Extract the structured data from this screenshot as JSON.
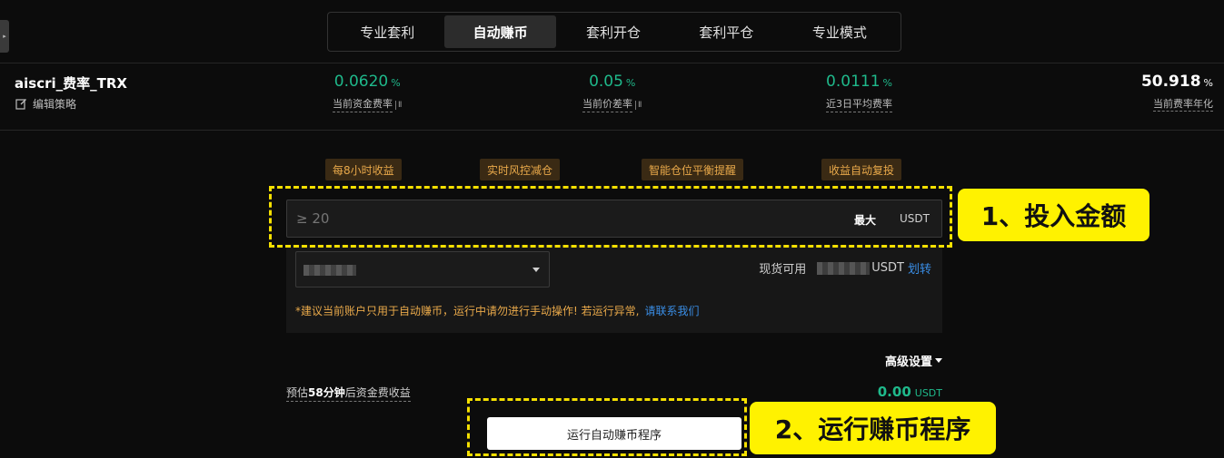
{
  "tabs": [
    {
      "label": "专业套利",
      "active": false
    },
    {
      "label": "自动赚币",
      "active": true
    },
    {
      "label": "套利开仓",
      "active": false
    },
    {
      "label": "套利平仓",
      "active": false
    },
    {
      "label": "专业模式",
      "active": false
    }
  ],
  "strategy": {
    "name": "aiscri_费率_TRX",
    "edit_label": "编辑策略"
  },
  "stats": {
    "current_funding": {
      "value": "0.0620",
      "unit": "%",
      "label": "当前资金费率"
    },
    "current_spread": {
      "value": "0.05",
      "unit": "%",
      "label": "当前价差率"
    },
    "avg_3day": {
      "value": "0.0111",
      "unit": "%",
      "label": "近3日平均费率"
    },
    "annualized": {
      "value": "50.918",
      "unit": "%",
      "label": "当前费率年化"
    }
  },
  "features": [
    "每8小时收益",
    "实时风控减仓",
    "智能仓位平衡提醒",
    "收益自动复投"
  ],
  "amount_input": {
    "placeholder": "≥ 20",
    "max_label": "最大",
    "currency": "USDT"
  },
  "account": {
    "available_label": "现货可用",
    "currency": "USDT",
    "transfer_label": "划转"
  },
  "notice": {
    "text": "*建议当前账户只用于自动赚币，运行中请勿进行手动操作! 若运行异常,",
    "link": "请联系我们"
  },
  "advanced_label": "高级设置",
  "estimate": {
    "prefix": "预估",
    "minutes": "58分钟",
    "suffix": "后资金费收益",
    "value": "0.00",
    "unit": "USDT"
  },
  "run_button": "运行自动赚币程序",
  "annotations": {
    "step1": "1、投入金额",
    "step2": "2、运行赚币程序"
  },
  "colors": {
    "positive": "#1fb98b",
    "warning": "#e9a94a",
    "link": "#3a8ee6",
    "highlight": "#fff200"
  }
}
